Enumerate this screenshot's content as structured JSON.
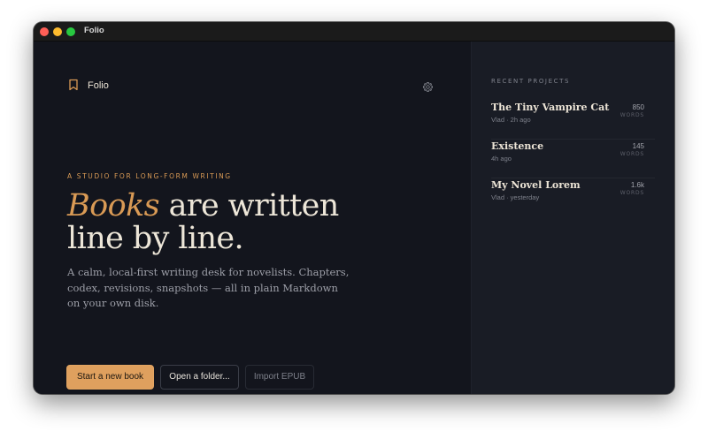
{
  "window": {
    "title": "Folio"
  },
  "brand": {
    "name": "Folio",
    "icon": "bookmark-icon",
    "accent": "#d99a55"
  },
  "settings": {
    "icon": "gear-icon"
  },
  "hero": {
    "eyebrow": "A STUDIO FOR LONG-FORM WRITING",
    "headline_accent": "Books",
    "headline_rest_1": " are written",
    "headline_line_2": "line by line.",
    "lede": "A calm, local-first writing desk for novelists. Chapters, codex, revisions, snapshots — all in plain Markdown on your own disk."
  },
  "actions": {
    "primary": "Start a new book",
    "secondary": "Open a folder...",
    "tertiary": "Import EPUB"
  },
  "recent": {
    "heading": "RECENT PROJECTS",
    "projects": [
      {
        "title": "The Tiny Vampire Cat",
        "meta": "Vlad · 2h ago",
        "count": "850",
        "unit": "WORDS"
      },
      {
        "title": "Existence",
        "meta": "4h ago",
        "count": "145",
        "unit": "WORDS"
      },
      {
        "title": "My Novel Lorem",
        "meta": "Vlad · yesterday",
        "count": "1.6k",
        "unit": "WORDS"
      }
    ]
  },
  "colors": {
    "background": "#13151d",
    "sidebar": "#191c25",
    "primary_button": "#dfa05e",
    "text": "#ece4d6"
  }
}
